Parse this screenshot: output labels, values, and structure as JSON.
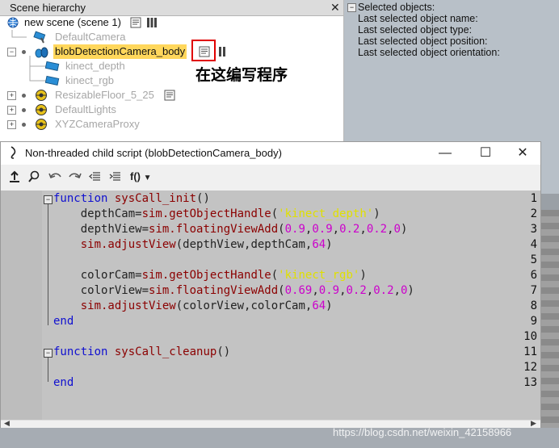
{
  "hierarchy": {
    "title": "Scene hierarchy",
    "close_glyph": "✕",
    "items": [
      {
        "label": "new scene (scene 1)"
      },
      {
        "label": "DefaultCamera"
      },
      {
        "label": "blobDetectionCamera_body"
      },
      {
        "label": "kinect_depth"
      },
      {
        "label": "kinect_rgb"
      },
      {
        "label": "ResizableFloor_5_25"
      },
      {
        "label": "DefaultLights"
      },
      {
        "label": "XYZCameraProxy"
      }
    ]
  },
  "info": {
    "lines": [
      "Selected objects:",
      "Last selected object name:",
      "Last selected object type:",
      "Last selected object position:",
      "Last selected object orientation:"
    ]
  },
  "annotation": {
    "text": "在这编写程序",
    "color": "#e00000"
  },
  "editor": {
    "title": "Non-threaded child script (blobDetectionCamera_body)",
    "toolbar": {
      "func_label": "f()"
    },
    "line_numbers": [
      "1",
      "2",
      "3",
      "4",
      "5",
      "6",
      "7",
      "8",
      "9",
      "10",
      "11",
      "12",
      "13"
    ]
  },
  "watermark": "https://blog.csdn.net/weixin_42158966"
}
